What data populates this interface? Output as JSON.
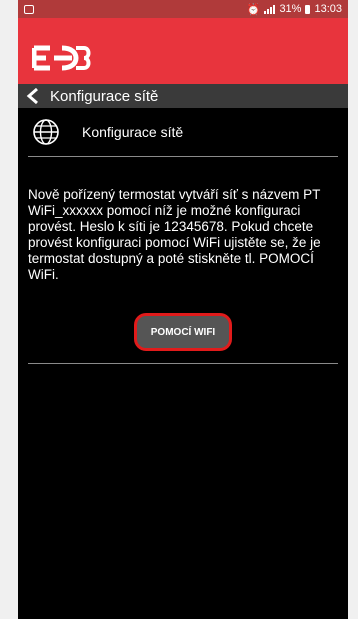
{
  "status_bar": {
    "battery_percent": "31%",
    "time": "13:03",
    "icons": [
      "app-icon",
      "alarm-icon",
      "signal-icon",
      "battery-icon"
    ]
  },
  "brand": {
    "logo_name": "EOB-logo",
    "logo_text": "EOB",
    "color": "#e8343d"
  },
  "title_bar": {
    "title": "Konfigurace sítě"
  },
  "section": {
    "icon": "globe-icon",
    "title": "Konfigurace sítě"
  },
  "description": "Nově pořízený termostat vytváří síť s názvem PT WiFi_xxxxxx pomocí níž je možné konfiguraci provést. Heslo k síti je 12345678. Pokud chcete provést konfiguraci pomocí WiFi ujistěte se, že je termostat dostupný a poté stiskněte tl. POMOCÍ WiFi.",
  "button": {
    "label": "POMOCÍ WIFI",
    "highlight_color": "#e11b1b"
  }
}
